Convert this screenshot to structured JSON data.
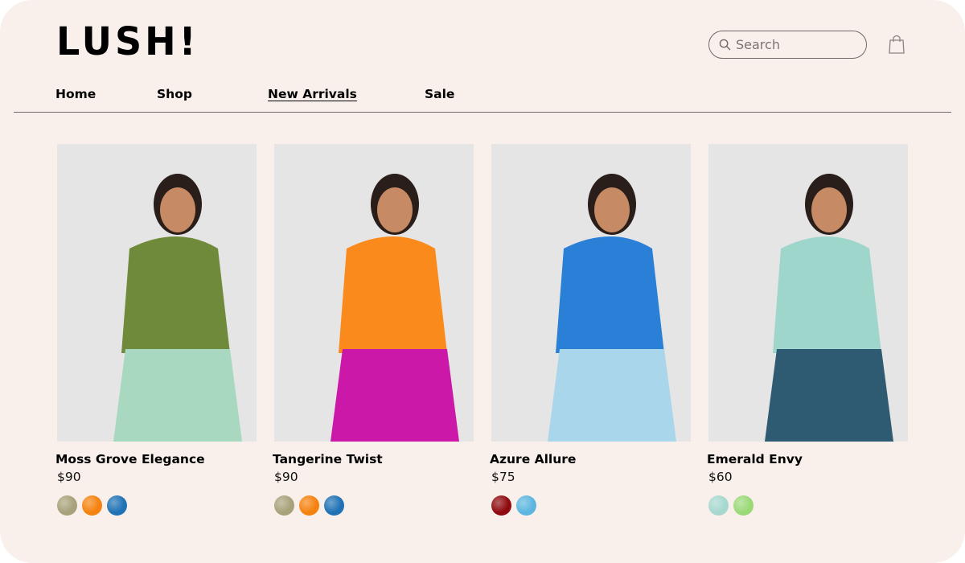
{
  "brand": {
    "logo": "LUSH!"
  },
  "header": {
    "search_placeholder": "Search",
    "search_icon": "search-icon",
    "cart_icon": "shopping-bag-icon"
  },
  "nav": {
    "items": [
      {
        "label": "Home",
        "active": false
      },
      {
        "label": "Shop",
        "active": false
      },
      {
        "label": "New Arrivals",
        "active": true
      },
      {
        "label": "Sale",
        "active": false
      }
    ]
  },
  "products": [
    {
      "name": "Moss Grove Elegance",
      "price": "$90",
      "swatches": [
        "#a7a27a",
        "#f5820f",
        "#1f72b5"
      ],
      "top_color": "#6e8a3a",
      "bottom_color": "#a8d8bf"
    },
    {
      "name": "Tangerine Twist",
      "price": "$90",
      "swatches": [
        "#a7a27a",
        "#f5820f",
        "#1f72b5"
      ],
      "top_color": "#fb8a1c",
      "bottom_color": "#cc18a8"
    },
    {
      "name": "Azure Allure",
      "price": "$75",
      "swatches": [
        "#8e0a0e",
        "#5db6e0"
      ],
      "top_color": "#2a7fd6",
      "bottom_color": "#a9d6ea"
    },
    {
      "name": "Emerald Envy",
      "price": "$60",
      "swatches": [
        "#a6d8cf",
        "#9bd978"
      ],
      "top_color": "#9fd6cc",
      "bottom_color": "#2f5b72"
    }
  ]
}
